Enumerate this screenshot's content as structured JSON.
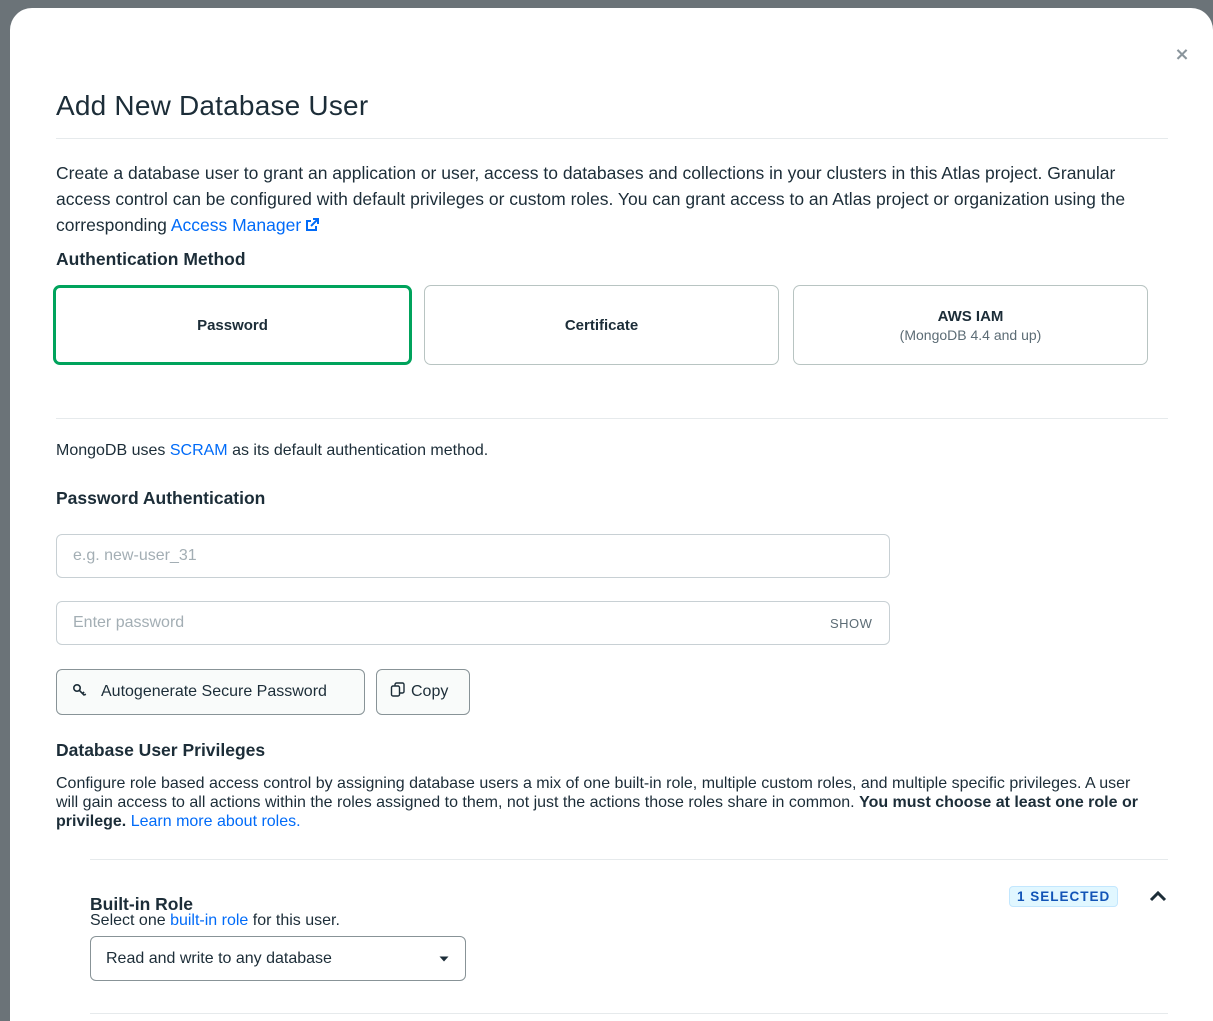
{
  "modal": {
    "title": "Add New Database User",
    "close_label": "×"
  },
  "intro": {
    "text_before_link": "Create a database user to grant an application or user, access to databases and collections in your clusters in this Atlas project. Granular access control can be configured with default privileges or custom roles. You can grant access to an Atlas project or organization using the corresponding ",
    "link_label": "Access Manager"
  },
  "auth_method": {
    "heading": "Authentication Method",
    "options": [
      {
        "label": "Password",
        "sub": ""
      },
      {
        "label": "Certificate",
        "sub": ""
      },
      {
        "label": "AWS IAM",
        "sub": "(MongoDB 4.4 and up)"
      }
    ],
    "selected": "Password",
    "selected_color": "#00a35c"
  },
  "scram_note": {
    "before": "MongoDB uses ",
    "link": "SCRAM",
    "after": " as its default authentication method."
  },
  "password_auth": {
    "heading": "Password Authentication",
    "username_placeholder": "e.g. new-user_31",
    "username_value": "",
    "password_placeholder": "Enter password",
    "password_value": "",
    "show_label": "SHOW",
    "autogen_label": "Autogenerate Secure Password",
    "copy_label": "Copy"
  },
  "privileges": {
    "heading": "Database User Privileges",
    "description": "Configure role based access control by assigning database users a mix of one built-in role, multiple custom roles, and multiple specific privileges. A user will gain access to all actions within the roles assigned to them, not just the actions those roles share in common. ",
    "bold_text": "You must choose at least one role or privilege.",
    "learn_more": "Learn more about roles."
  },
  "builtin_role": {
    "title": "Built-in Role",
    "sub_before": "Select one ",
    "sub_link": "built-in role",
    "sub_after": " for this user.",
    "badge": "1 SELECTED",
    "selected_value": "Read and write to any database"
  },
  "icons": {
    "close": "close-icon",
    "external": "external-link-icon",
    "key": "key-icon",
    "copy": "copy-icon",
    "chevron_up": "chevron-up-icon",
    "caret_down": "caret-down-icon"
  }
}
